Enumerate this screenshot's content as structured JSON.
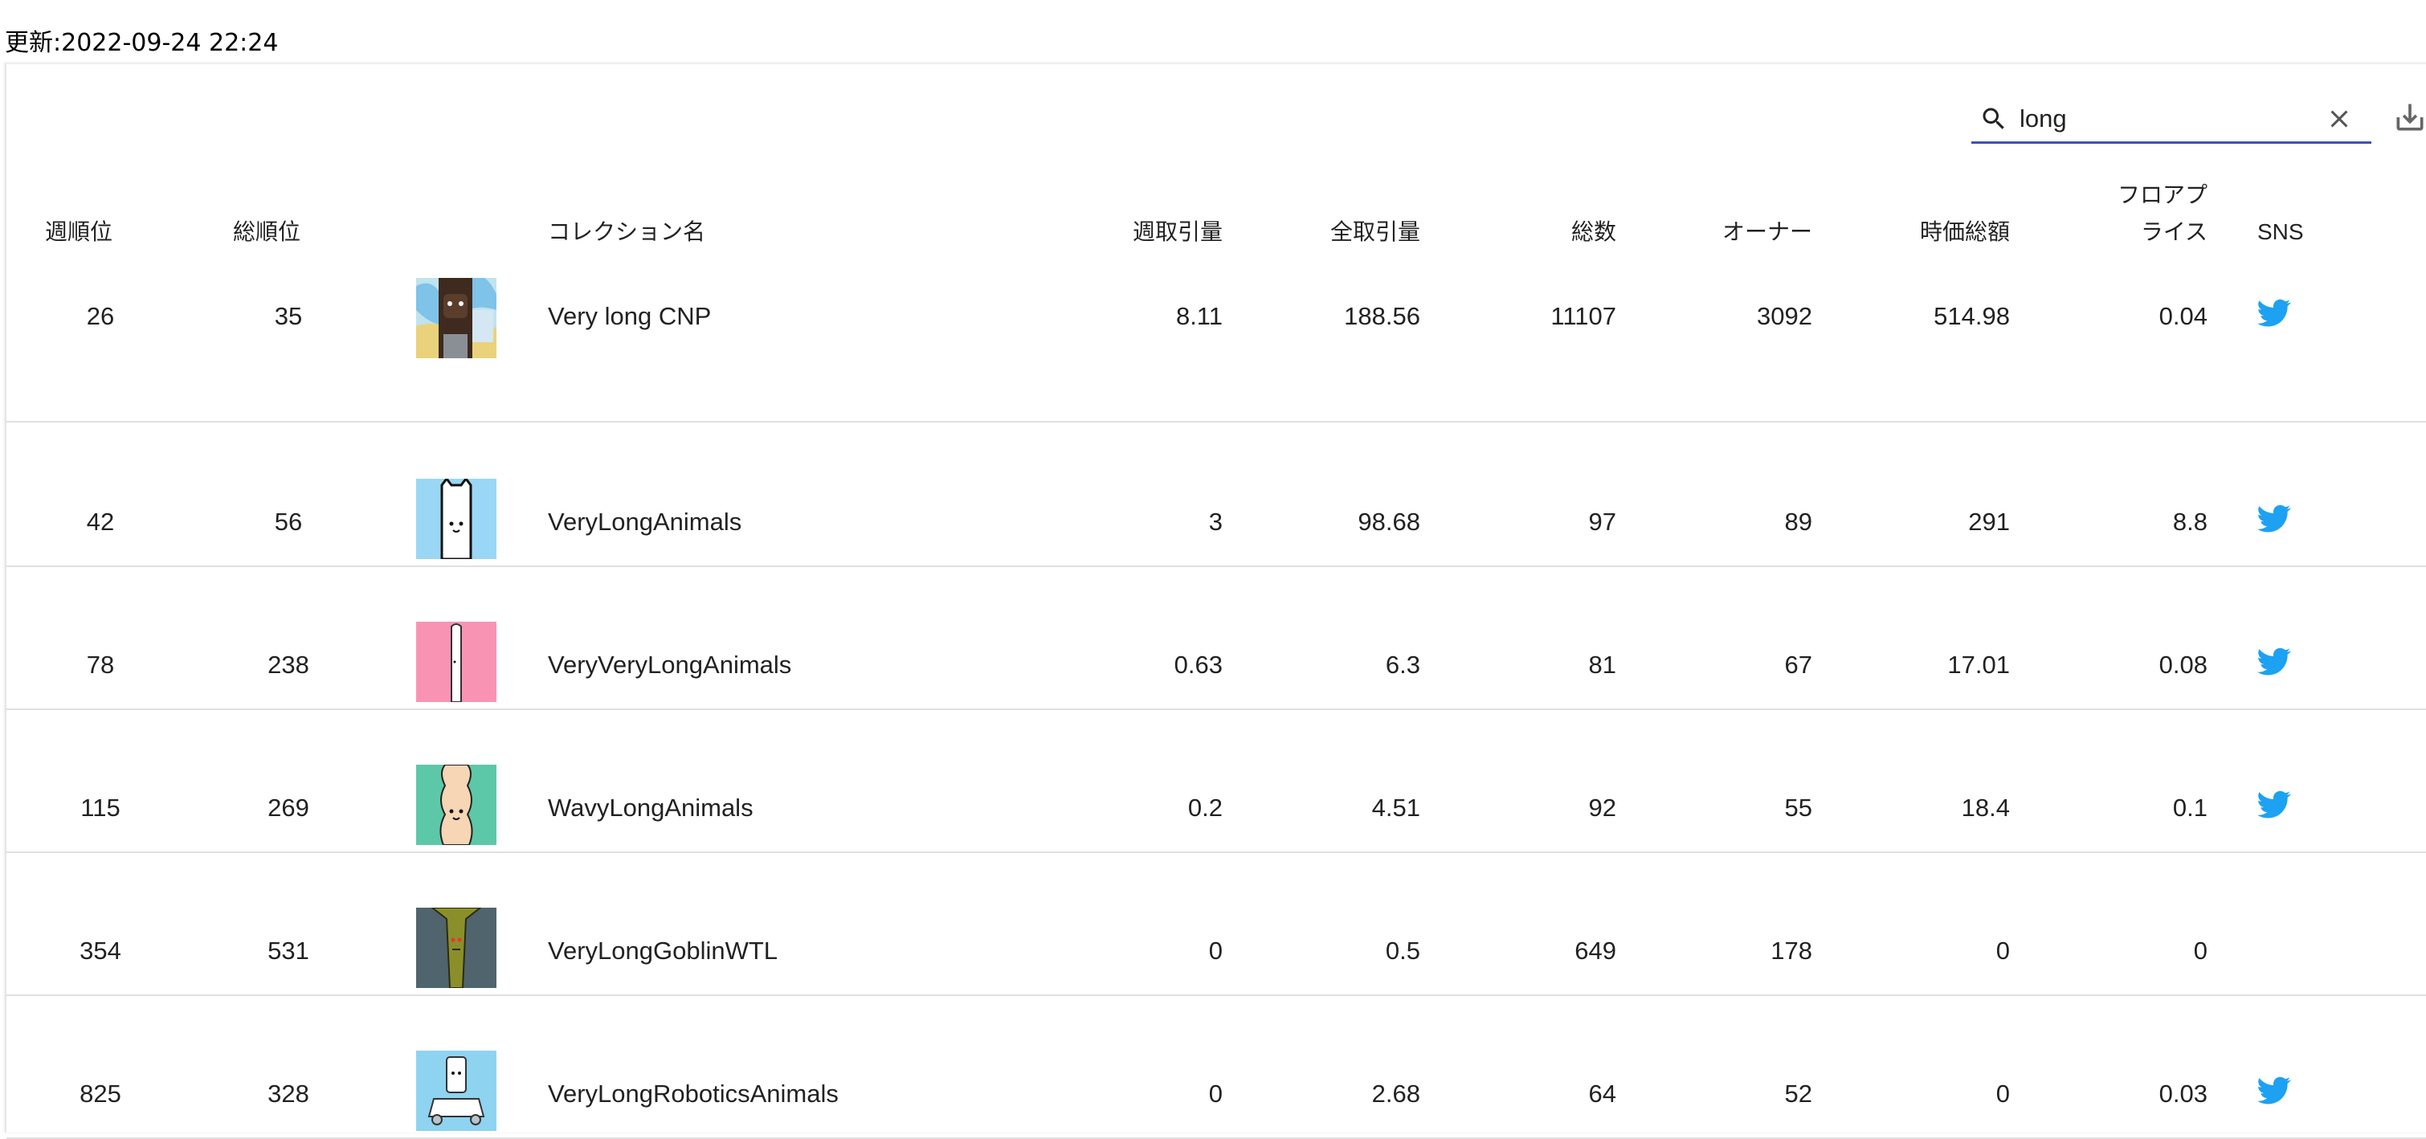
{
  "updated_text": "更新:2022-09-24 22:24",
  "search": {
    "value": "long",
    "icon": "search-icon",
    "clear_icon": "close-icon"
  },
  "toolbar": {
    "download_icon": "download-icon"
  },
  "colors": {
    "accent": "#3f51b5",
    "twitter": "#1da1f2",
    "divider": "#e0e0e0"
  },
  "columns": {
    "weekly_rank": "週順位",
    "total_rank": "総順位",
    "collection_name": "コレクション名",
    "weekly_volume": "週取引量",
    "total_volume": "全取引量",
    "total_count": "総数",
    "owners": "オーナー",
    "market_cap": "時価総額",
    "floor_price_line1": "フロアプ",
    "floor_price_line2": "ライス",
    "sns": "SNS"
  },
  "rows": [
    {
      "weekly_rank": "26",
      "total_rank": "35",
      "name": "Very long CNP",
      "weekly_volume": "8.11",
      "total_volume": "188.56",
      "total_count": "11107",
      "owners": "3092",
      "market_cap": "514.98",
      "floor_price": "0.04",
      "twitter": true
    },
    {
      "weekly_rank": "42",
      "total_rank": "56",
      "name": "VeryLongAnimals",
      "weekly_volume": "3",
      "total_volume": "98.68",
      "total_count": "97",
      "owners": "89",
      "market_cap": "291",
      "floor_price": "8.8",
      "twitter": true
    },
    {
      "weekly_rank": "78",
      "total_rank": "238",
      "name": "VeryVeryLongAnimals",
      "weekly_volume": "0.63",
      "total_volume": "6.3",
      "total_count": "81",
      "owners": "67",
      "market_cap": "17.01",
      "floor_price": "0.08",
      "twitter": true
    },
    {
      "weekly_rank": "115",
      "total_rank": "269",
      "name": "WavyLongAnimals",
      "weekly_volume": "0.2",
      "total_volume": "4.51",
      "total_count": "92",
      "owners": "55",
      "market_cap": "18.4",
      "floor_price": "0.1",
      "twitter": true
    },
    {
      "weekly_rank": "354",
      "total_rank": "531",
      "name": "VeryLongGoblinWTL",
      "weekly_volume": "0",
      "total_volume": "0.5",
      "total_count": "649",
      "owners": "178",
      "market_cap": "0",
      "floor_price": "0",
      "twitter": false
    },
    {
      "weekly_rank": "825",
      "total_rank": "328",
      "name": "VeryLongRoboticsAnimals",
      "weekly_volume": "0",
      "total_volume": "2.68",
      "total_count": "64",
      "owners": "52",
      "market_cap": "0",
      "floor_price": "0.03",
      "twitter": true
    }
  ]
}
